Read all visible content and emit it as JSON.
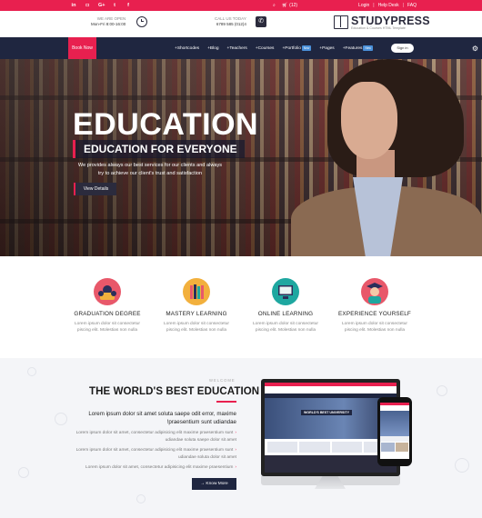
{
  "topbar": {
    "social_icons": [
      "linkedin-icon",
      "instagram-icon",
      "google-plus-icon",
      "twitter-icon",
      "facebook-icon"
    ],
    "cart_count": "(12)",
    "links": [
      "Login",
      "Help Desk",
      "FAQ"
    ]
  },
  "header": {
    "open_label": "WE ARE OPEN",
    "open_hours": "Mon-Fri 8:00-16:00",
    "call_label": "CALL US TODAY",
    "call_number": "6789 585 (012)4",
    "logo_name": "STUDYPRESS",
    "logo_tagline": "Education & Courses HTML Template"
  },
  "nav": {
    "book_now": "Book Now",
    "items": [
      {
        "label": "Shortcodes"
      },
      {
        "label": "Blog"
      },
      {
        "label": "Teachers"
      },
      {
        "label": "Courses"
      },
      {
        "label": "Portfolio",
        "badge": "New"
      },
      {
        "label": "Pages"
      },
      {
        "label": "Features",
        "badge": "New"
      }
    ],
    "signin": "Sign in"
  },
  "hero": {
    "title": "EDUCATION",
    "subtitle": "EDUCATION FOR EVERYONE",
    "desc_line1": "We provides always our best services for our clients and always",
    "desc_line2": "try to achieve our client's trust and satisfaction",
    "button": "View Details"
  },
  "features": [
    {
      "title": "GRADUATION DEGREE",
      "text1": "Lorem ipsum dolor sit consectetur",
      "text2": "piscing elit. Molestias non nulla",
      "icon": "graduation-icon",
      "color": "#e8586a"
    },
    {
      "title": "MASTERY LEARNING",
      "text1": "Lorem ipsum dolor sit consectetur",
      "text2": "piscing elit. Molestias non nulla",
      "icon": "books-icon",
      "color": "#f2b03d"
    },
    {
      "title": "ONLINE LEARNING",
      "text1": "Lorem ipsum dolor sit consectetur",
      "text2": "piscing elit. Molestias non nulla",
      "icon": "computer-icon",
      "color": "#1ea7a0"
    },
    {
      "title": "EXPERIENCE YOURSELF",
      "text1": "Lorem ipsum dolor sit consectetur",
      "text2": "piscing elit. Molestias non nulla",
      "icon": "graduate-avatar-icon",
      "color": "#e8586a"
    }
  ],
  "about": {
    "welcome": "WELCOME",
    "title": "THE WORLD'S BEST EDUCATION",
    "lead_line1": "Lorem ipsum dolor sit amet soluta saepe odit error, maxime",
    "lead_line2": "!praesentium sunt udiandae",
    "items": [
      {
        "line1": "Lorem ipsum dolor sit amet, consectetur adipisicing elit maxime praesentium sunt",
        "line2": "udiandae soluta saepe dolor sit amet"
      },
      {
        "line1": "Lorem ipsum dolor sit amet, consectetur adipisicing elit maxime praesentium sunt",
        "line2": "udiandae soluta dolor sit amet"
      },
      {
        "line1": "Lorem ipsum dolor sit amet, consectetur adipisicing elit maxime praesentium",
        "line2": ""
      }
    ],
    "button": "→ Know More",
    "screen_banner": "WORLD'S BEST UNIVERSITY"
  },
  "colors": {
    "accent": "#e8204f",
    "navy": "#1f2640"
  }
}
